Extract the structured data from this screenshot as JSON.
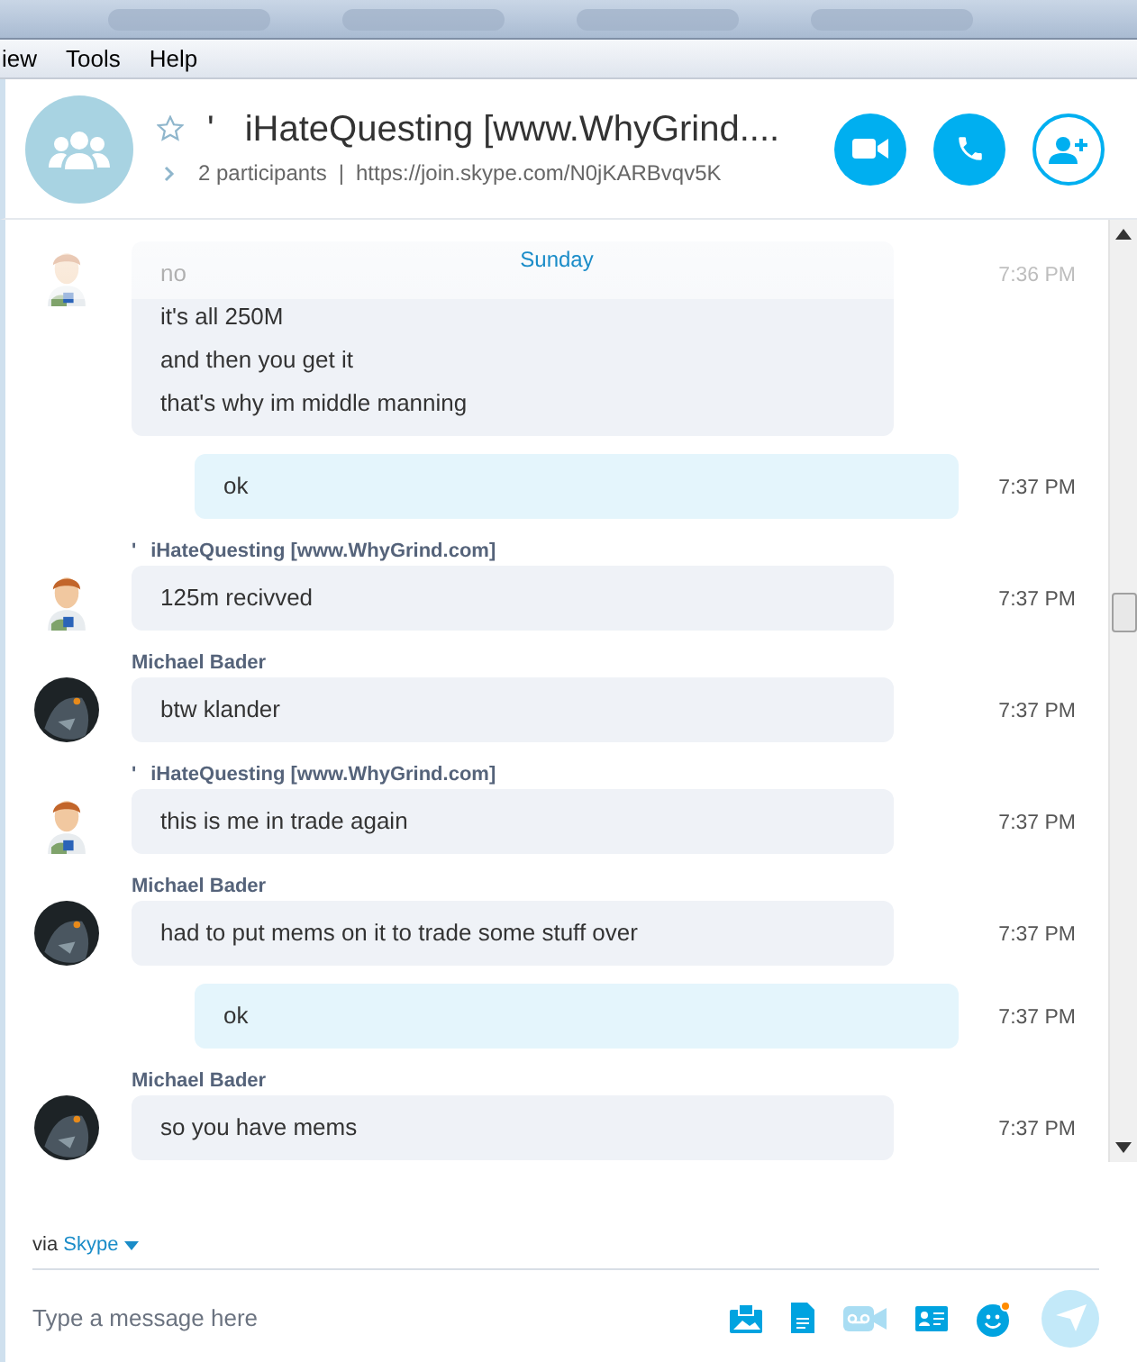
{
  "menu": [
    "iew",
    "Tools",
    "Help"
  ],
  "header": {
    "title_prefix": "'",
    "title": "iHateQuesting [www.WhyGrind....",
    "starred": false,
    "participants": "2 participants",
    "separator": "|",
    "link": "https://join.skype.com/N0jKARBvqv5K"
  },
  "date_divider": "Sunday",
  "messages": [
    {
      "kind": "incoming",
      "avatar": {
        "kind": "light"
      },
      "lines": [
        "no",
        "it's all 250M",
        "and then you get it",
        "that's why im middle manning"
      ],
      "time": "7:36 PM"
    },
    {
      "kind": "outgoing",
      "lines": [
        "ok"
      ],
      "time": "7:37 PM"
    },
    {
      "kind": "incoming",
      "avatar": {
        "kind": "light"
      },
      "sender_prefix": "'",
      "sender": "iHateQuesting [www.WhyGrind.com]",
      "lines": [
        "125m recivved"
      ],
      "time": "7:37 PM"
    },
    {
      "kind": "incoming",
      "avatar": {
        "kind": "dark"
      },
      "sender": "Michael Bader",
      "lines": [
        "btw klander"
      ],
      "time": "7:37 PM"
    },
    {
      "kind": "incoming",
      "avatar": {
        "kind": "light"
      },
      "sender_prefix": "'",
      "sender": "iHateQuesting [www.WhyGrind.com]",
      "lines": [
        "this is me in trade again"
      ],
      "time": "7:37 PM"
    },
    {
      "kind": "incoming",
      "avatar": {
        "kind": "dark"
      },
      "sender": "Michael Bader",
      "lines": [
        "had to put mems on it to trade some stuff over"
      ],
      "time": "7:37 PM"
    },
    {
      "kind": "outgoing",
      "lines": [
        "ok"
      ],
      "time": "7:37 PM"
    },
    {
      "kind": "incoming",
      "avatar": {
        "kind": "dark"
      },
      "sender": "Michael Bader",
      "lines": [
        "so you have mems"
      ],
      "time": "7:37 PM"
    }
  ],
  "via": {
    "label": "via",
    "service": "Skype"
  },
  "composer": {
    "placeholder": "Type a message here",
    "emoji_notification": true
  }
}
